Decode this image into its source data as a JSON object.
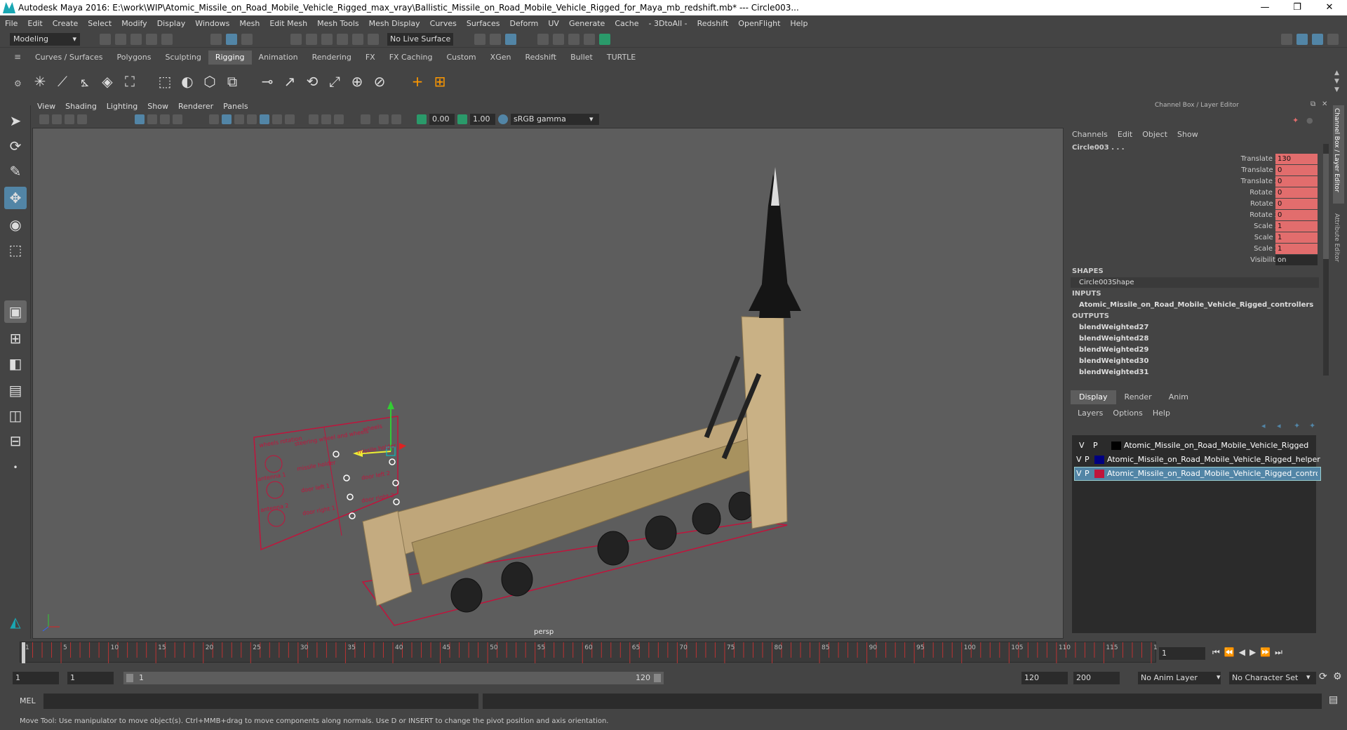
{
  "window": {
    "title": "Autodesk Maya 2016: E:\\work\\WIP\\Atomic_Missile_on_Road_Mobile_Vehicle_Rigged_max_vray\\Ballistic_Missile_on_Road_Mobile_Vehicle_Rigged_for_Maya_mb_redshift.mb*   ---   Circle003...",
    "minimize": "—",
    "maximize": "❐",
    "close": "✕"
  },
  "menubar": [
    "File",
    "Edit",
    "Create",
    "Select",
    "Modify",
    "Display",
    "Windows",
    "Mesh",
    "Edit Mesh",
    "Mesh Tools",
    "Mesh Display",
    "Curves",
    "Surfaces",
    "Deform",
    "UV",
    "Generate",
    "Cache",
    "- 3DtoAll -",
    "Redshift",
    "OpenFlight",
    "Help"
  ],
  "statusline": {
    "mode": "Modeling",
    "live_surface": "No Live Surface"
  },
  "shelf_tabs": [
    "Curves / Surfaces",
    "Polygons",
    "Sculpting",
    "Rigging",
    "Animation",
    "Rendering",
    "FX",
    "FX Caching",
    "Custom",
    "XGen",
    "Redshift",
    "Bullet",
    "TURTLE"
  ],
  "shelf_active": "Rigging",
  "viewport": {
    "menu": [
      "View",
      "Shading",
      "Lighting",
      "Show",
      "Renderer",
      "Panels"
    ],
    "exposure": "0.00",
    "gamma": "1.00",
    "colorspace": "sRGB gamma",
    "camera_label": "persp",
    "controls": {
      "wheels_rotation": "wheels rotation",
      "steering": "steering wheel and wheels",
      "wheels": "wheels",
      "missile_holder": "missile holder",
      "missile_rot": "missile holder",
      "antenna1": "antenna 1",
      "door_left1": "door left 1",
      "door_left2": "door left 2",
      "antenna2": "antenna 2",
      "door_right1": "door right 1",
      "door_right2": "door right 2"
    }
  },
  "channelbox": {
    "header": "Channel Box / Layer Editor",
    "menu": [
      "Channels",
      "Edit",
      "Object",
      "Show"
    ],
    "object": "Circle003 . . .",
    "channels": [
      {
        "label": "Translate X",
        "value": "130",
        "keyed": true
      },
      {
        "label": "Translate Y",
        "value": "0",
        "keyed": true
      },
      {
        "label": "Translate Z",
        "value": "0",
        "keyed": true
      },
      {
        "label": "Rotate X",
        "value": "0",
        "keyed": true
      },
      {
        "label": "Rotate Y",
        "value": "0",
        "keyed": true
      },
      {
        "label": "Rotate Z",
        "value": "0",
        "keyed": true
      },
      {
        "label": "Scale X",
        "value": "1",
        "keyed": true
      },
      {
        "label": "Scale Y",
        "value": "1",
        "keyed": true
      },
      {
        "label": "Scale Z",
        "value": "1",
        "keyed": true
      },
      {
        "label": "Visibility",
        "value": "on",
        "keyed": false
      }
    ],
    "shapes_label": "SHAPES",
    "shape": "Circle003Shape",
    "inputs_label": "INPUTS",
    "input": "Atomic_Missile_on_Road_Mobile_Vehicle_Rigged_controllers",
    "outputs_label": "OUTPUTS",
    "outputs": [
      "blendWeighted27",
      "blendWeighted28",
      "blendWeighted29",
      "blendWeighted30",
      "blendWeighted31"
    ],
    "side_tabs": [
      "Channel Box / Layer Editor",
      "Attribute Editor"
    ]
  },
  "layer_editor": {
    "tabs": [
      "Display",
      "Render",
      "Anim"
    ],
    "active_tab": "Display",
    "menu": [
      "Layers",
      "Options",
      "Help"
    ],
    "layers": [
      {
        "v": "V",
        "p": "P",
        "name": "Atomic_Missile_on_Road_Mobile_Vehicle_Rigged",
        "color": "#000000",
        "selected": false
      },
      {
        "v": "V",
        "p": "P",
        "name": "Atomic_Missile_on_Road_Mobile_Vehicle_Rigged_helper",
        "color": "#000080",
        "selected": false
      },
      {
        "v": "V",
        "p": "P",
        "name": "Atomic_Missile_on_Road_Mobile_Vehicle_Rigged_contro",
        "color": "#c0143c",
        "selected": true
      }
    ]
  },
  "timeline": {
    "ticks": [
      "1",
      "5",
      "10",
      "15",
      "20",
      "25",
      "30",
      "35",
      "40",
      "45",
      "50",
      "55",
      "60",
      "65",
      "70",
      "75",
      "80",
      "85",
      "90",
      "95",
      "100",
      "105",
      "110",
      "115",
      "120"
    ],
    "current_frame": "1"
  },
  "range": {
    "start": "1",
    "playback_start": "1",
    "slider_start": "1",
    "slider_end": "120",
    "playback_end": "120",
    "end": "200",
    "anim_layer": "No Anim Layer",
    "char_set": "No Character Set"
  },
  "cmdline": {
    "label": "MEL"
  },
  "helpline": "Move Tool: Use manipulator to move object(s). Ctrl+MMB+drag to move components along normals. Use D or INSERT to change the pivot position and axis orientation."
}
